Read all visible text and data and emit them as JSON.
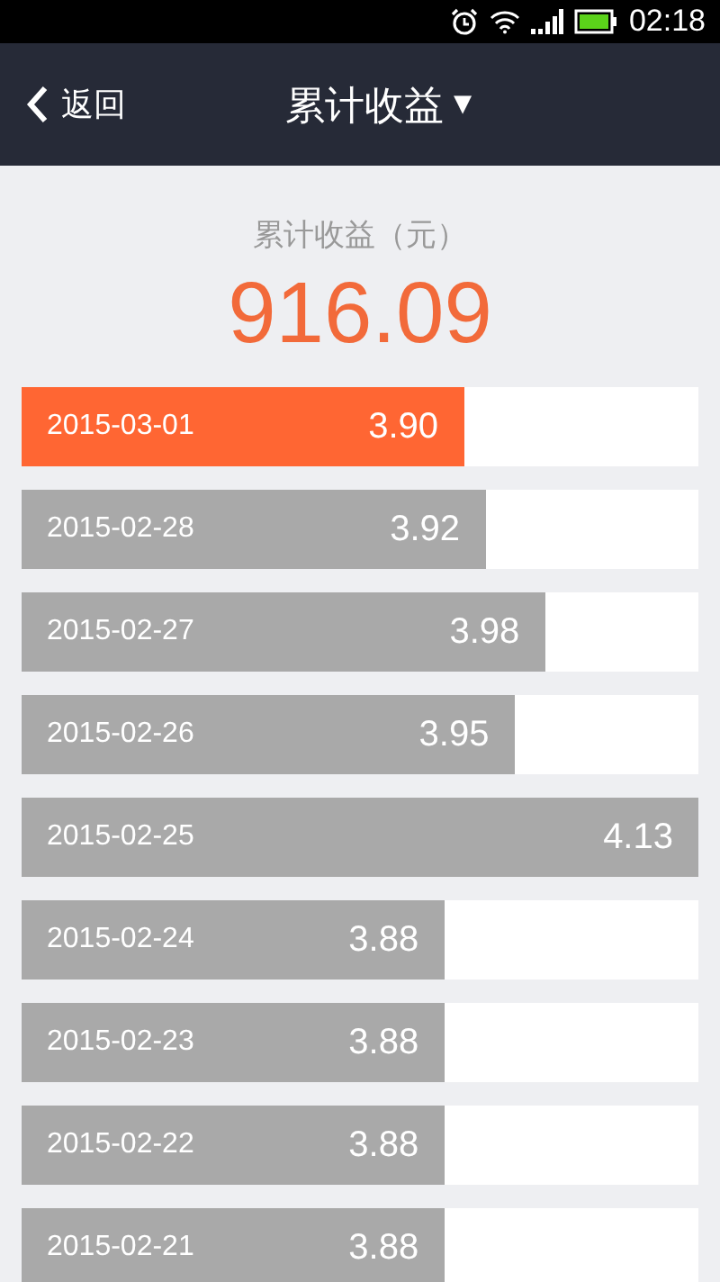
{
  "status_bar": {
    "time": "02:18"
  },
  "nav": {
    "back": "返回",
    "title": "累计收益",
    "dropdown": "▼"
  },
  "summary": {
    "label": "累计收益（元）",
    "value": "916.09"
  },
  "rows": [
    {
      "date": "2015-03-01",
      "value": "3.90",
      "level": 0.653,
      "selected": true
    },
    {
      "date": "2015-02-28",
      "value": "3.92",
      "level": 0.685,
      "selected": false
    },
    {
      "date": "2015-02-27",
      "value": "3.98",
      "level": 0.773,
      "selected": false
    },
    {
      "date": "2015-02-26",
      "value": "3.95",
      "level": 0.728,
      "selected": false
    },
    {
      "date": "2015-02-25",
      "value": "4.13",
      "level": 1,
      "selected": false
    },
    {
      "date": "2015-02-24",
      "value": "3.88",
      "level": 0.624,
      "selected": false
    },
    {
      "date": "2015-02-23",
      "value": "3.88",
      "level": 0.624,
      "selected": false
    },
    {
      "date": "2015-02-22",
      "value": "3.88",
      "level": 0.624,
      "selected": false
    },
    {
      "date": "2015-02-21",
      "value": "3.88",
      "level": 0.624,
      "selected": false
    }
  ]
}
